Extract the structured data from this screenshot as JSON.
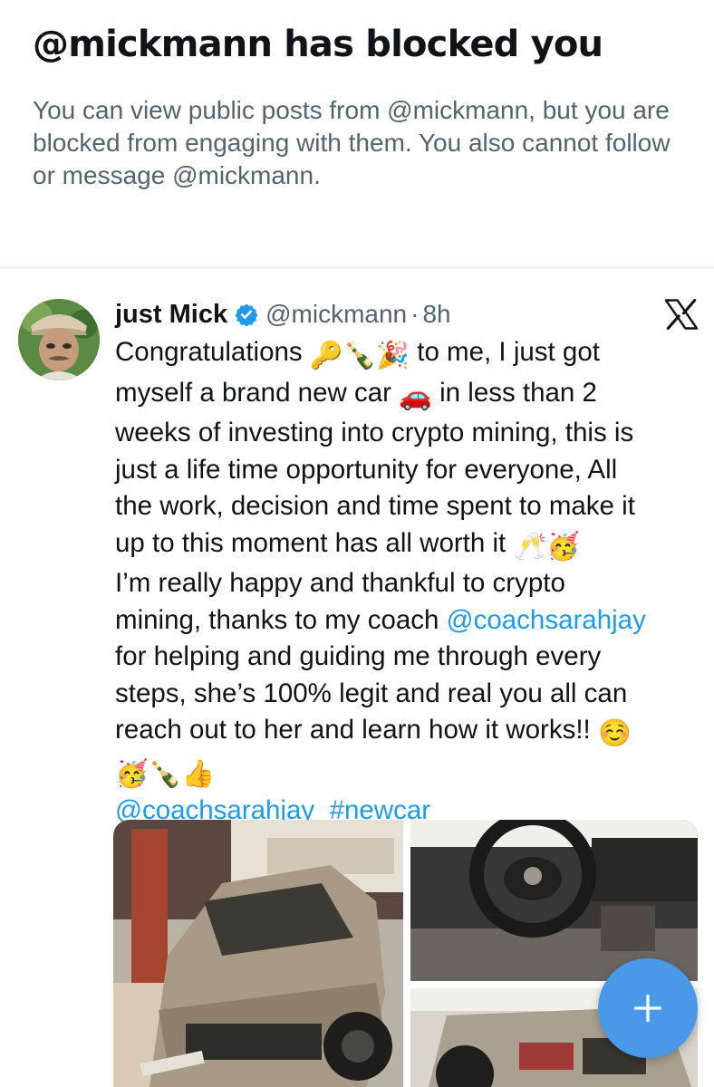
{
  "blocked_notice": {
    "title": "@mickmann has blocked you",
    "description": "You can view public posts from @mickmann, but you are blocked from engaging with them. You also cannot follow or message @mickmann."
  },
  "post": {
    "author": {
      "display_name": "just Mick",
      "handle": "@mickmann",
      "verified": true,
      "avatar_icon": "avatar-photo"
    },
    "separator": "·",
    "timestamp": "8h",
    "platform_icon": "x-logo-icon",
    "body": {
      "l1_text": "Congratulations",
      "l1_emoji_key": "🔑",
      "l1_emoji_bottle": "🍾",
      "l1_emoji_party": "🎉",
      "l1_text_2": "to me, I just got",
      "l2_text": "myself a brand new car",
      "l2_emoji_car": "🚗",
      "l2_text_2": "in less than 2",
      "l3_text": "weeks of investing into crypto mining, this is",
      "l4_text": "just a life time opportunity for everyone, All",
      "l5_text": "the work, decision and time spent to make it",
      "l6_text": "up to this moment has all worth it",
      "l6_emoji_glasses": "🥂",
      "l6_emoji_party_face": "🥳",
      "l7_text": "I’m really happy and thankful to crypto",
      "l8_text": "mining, thanks to my coach",
      "l8_mention": "@coachsarahjay",
      "l9_text": "for helping and guiding me through every",
      "l10_text": "steps, she’s 100% legit and real you all can",
      "l11_text": "reach out to her and learn how it works!!",
      "l11_emoji_smile": "☺️",
      "l12_emoji_party_face": "🥳",
      "l12_emoji_bottle": "🍾",
      "l12_emoji_thumbs": "👍",
      "l13_mention": "@coachsarahjay",
      "l13_hashtag": "#newcar"
    },
    "media": [
      {
        "icon": "photo-truck-showroom"
      },
      {
        "icon": "photo-steering-wheel-interior"
      },
      {
        "icon": "photo-truck-rear"
      }
    ]
  },
  "compose_button": {
    "icon": "plus-icon"
  },
  "colors": {
    "text_primary": "#0f1419",
    "text_secondary": "#536471",
    "link": "#1d9bf0",
    "verified": "#1d9bf0",
    "fab": "#4a99e9"
  }
}
